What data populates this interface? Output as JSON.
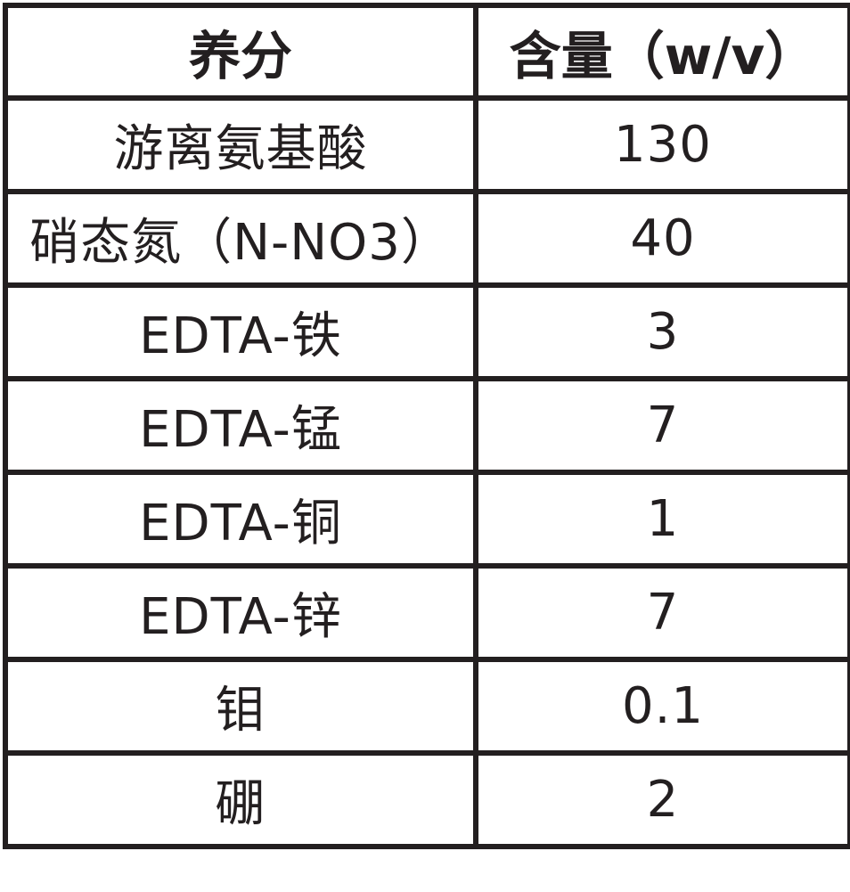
{
  "table": {
    "headers": [
      "养分",
      "含量（w/v）"
    ],
    "rows": [
      {
        "nutrient": "游离氨基酸",
        "amount": "130"
      },
      {
        "nutrient": "硝态氮（N-NO3）",
        "amount": "40"
      },
      {
        "nutrient": "EDTA-铁",
        "amount": "3"
      },
      {
        "nutrient": "EDTA-锰",
        "amount": "7"
      },
      {
        "nutrient": "EDTA-铜",
        "amount": "1"
      },
      {
        "nutrient": "EDTA-锌",
        "amount": "7"
      },
      {
        "nutrient": "钼",
        "amount": "0.1"
      },
      {
        "nutrient": "硼",
        "amount": "2"
      }
    ]
  },
  "colors": {
    "border": "#231f20",
    "text": "#231f20",
    "background": "#ffffff"
  }
}
